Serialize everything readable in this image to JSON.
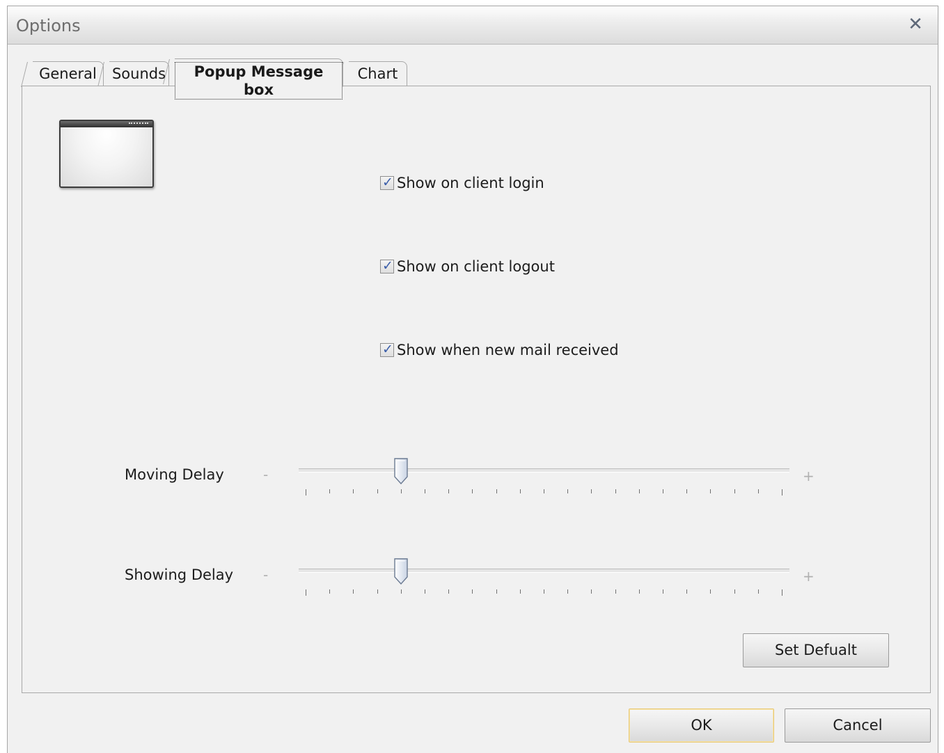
{
  "window": {
    "title": "Options",
    "close_glyph": "✕"
  },
  "tabs": [
    {
      "label": "General",
      "active": false
    },
    {
      "label": "Sounds",
      "active": false
    },
    {
      "label": "Popup Message box",
      "active": true
    },
    {
      "label": "Chart",
      "active": false
    }
  ],
  "panel": {
    "icon": "popup-window-icon",
    "checkboxes": [
      {
        "label": "Show on client login",
        "checked": true
      },
      {
        "label": "Show on client logout",
        "checked": true
      },
      {
        "label": "Show when new mail received",
        "checked": true
      }
    ],
    "sliders": [
      {
        "label": "Moving Delay",
        "min_symbol": "-",
        "max_symbol": "+",
        "value_fraction": 0.2,
        "tick_count": 21
      },
      {
        "label": "Showing Delay",
        "min_symbol": "-",
        "max_symbol": "+",
        "value_fraction": 0.2,
        "tick_count": 21
      }
    ],
    "set_default_label": "Set Defualt"
  },
  "footer": {
    "ok_label": "OK",
    "cancel_label": "Cancel"
  },
  "colors": {
    "check_tick": "#3b5ea9",
    "default_button_border": "#e8c977"
  }
}
